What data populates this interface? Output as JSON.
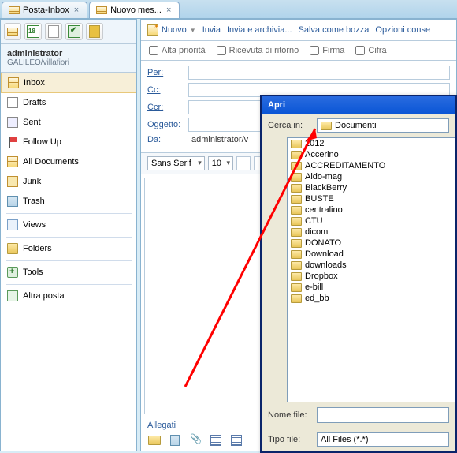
{
  "tabs": [
    {
      "label": "Posta-Inbox",
      "active": false
    },
    {
      "label": "Nuovo mes...",
      "active": true
    }
  ],
  "user": {
    "name": "administrator",
    "server": "GALILEO/villafiori"
  },
  "sidebar": {
    "items": [
      "Inbox",
      "Drafts",
      "Sent",
      "Follow Up",
      "All Documents",
      "Junk",
      "Trash"
    ],
    "views": "Views",
    "folders": "Folders",
    "tools": "Tools",
    "other": "Altra posta"
  },
  "compose_toolbar": {
    "new": "Nuovo",
    "send": "Invia",
    "send_archive": "Invia e archivia...",
    "save_draft": "Salva come bozza",
    "options": "Opzioni conse"
  },
  "checks": {
    "priority": "Alta priorità",
    "receipt": "Ricevuta di ritorno",
    "sign": "Firma",
    "encrypt": "Cifra"
  },
  "fields": {
    "to": "Per:",
    "cc": "Cc:",
    "bcc": "Ccr:",
    "subject": "Oggetto:",
    "from": "Da:",
    "from_value": "administrator/v"
  },
  "font": {
    "family": "Sans Serif",
    "size": "10"
  },
  "attachments": {
    "label": "Allegati"
  },
  "file_dialog": {
    "title": "Apri",
    "look_in": "Cerca in:",
    "look_in_value": "Documenti",
    "folders": [
      "2012",
      "Accerino",
      "ACCREDITAMENTO",
      "Aldo-mag",
      "BlackBerry",
      "BUSTE",
      "centralino",
      "CTU",
      "dicom",
      "DONATO",
      "Download",
      "downloads",
      "Dropbox",
      "e-bill",
      "ed_bb"
    ],
    "filename_label": "Nome file:",
    "filetype_label": "Tipo file:",
    "filetype_value": "All Files (*.*)"
  }
}
